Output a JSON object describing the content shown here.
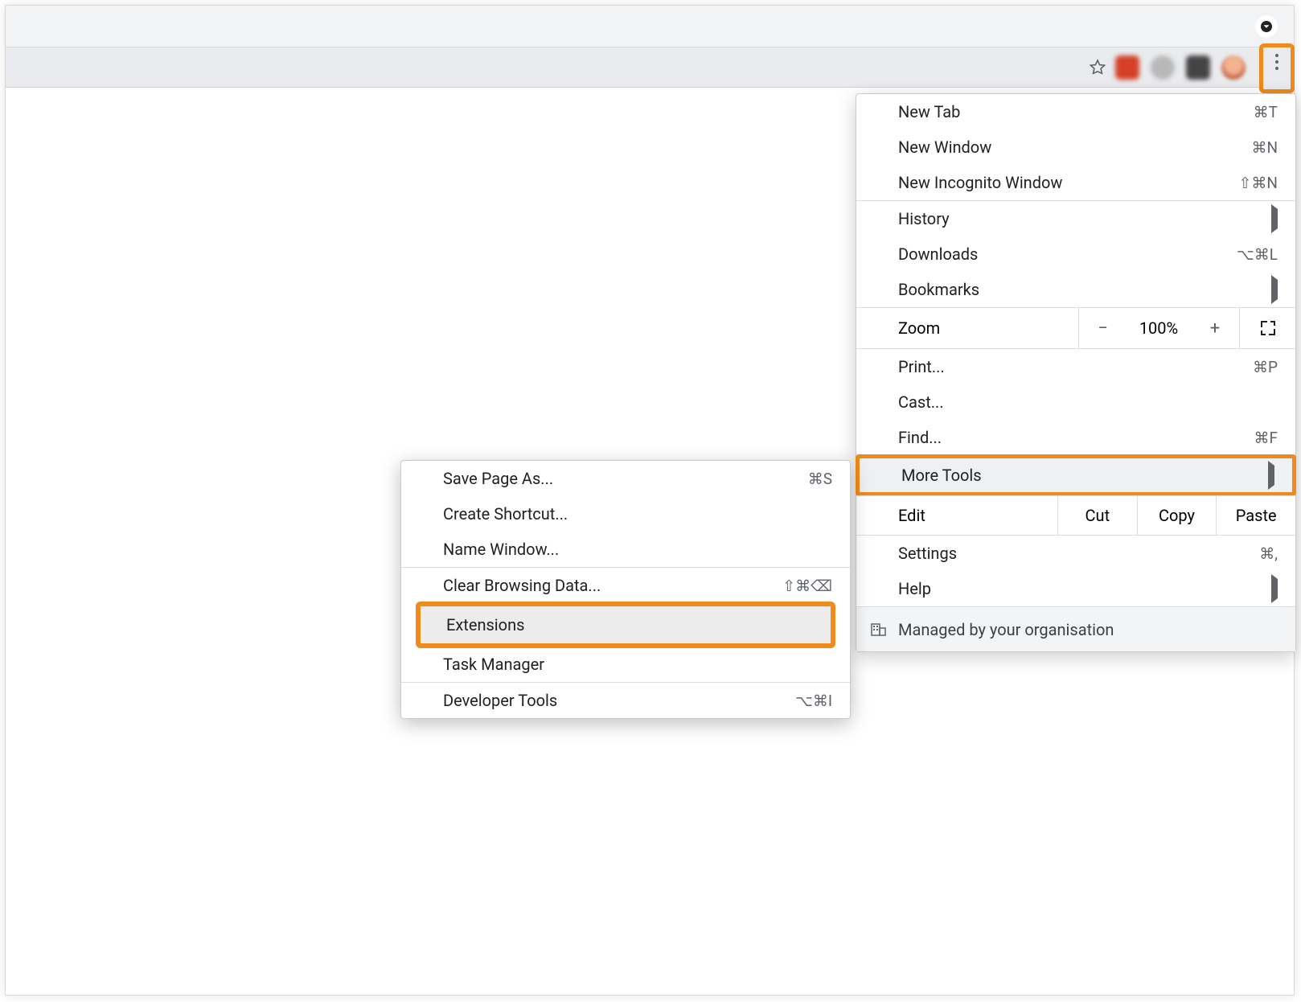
{
  "main_menu": {
    "new_tab": {
      "label": "New Tab",
      "shortcut": "⌘T"
    },
    "new_window": {
      "label": "New Window",
      "shortcut": "⌘N"
    },
    "new_incognito": {
      "label": "New Incognito Window",
      "shortcut": "⇧⌘N"
    },
    "history": {
      "label": "History"
    },
    "downloads": {
      "label": "Downloads",
      "shortcut": "⌥⌘L"
    },
    "bookmarks": {
      "label": "Bookmarks"
    },
    "zoom": {
      "label": "Zoom",
      "minus": "−",
      "percent": "100%",
      "plus": "+"
    },
    "print": {
      "label": "Print...",
      "shortcut": "⌘P"
    },
    "cast": {
      "label": "Cast..."
    },
    "find": {
      "label": "Find...",
      "shortcut": "⌘F"
    },
    "more_tools": {
      "label": "More Tools"
    },
    "edit": {
      "label": "Edit",
      "cut": "Cut",
      "copy": "Copy",
      "paste": "Paste"
    },
    "settings": {
      "label": "Settings",
      "shortcut": "⌘,"
    },
    "help": {
      "label": "Help"
    },
    "managed": {
      "label": "Managed by your organisation"
    }
  },
  "sub_menu": {
    "save_page": {
      "label": "Save Page As...",
      "shortcut": "⌘S"
    },
    "create_shortcut": {
      "label": "Create Shortcut..."
    },
    "name_window": {
      "label": "Name Window..."
    },
    "clear_browsing": {
      "label": "Clear Browsing Data...",
      "shortcut": "⇧⌘⌫"
    },
    "extensions": {
      "label": "Extensions"
    },
    "task_manager": {
      "label": "Task Manager"
    },
    "developer_tools": {
      "label": "Developer Tools",
      "shortcut": "⌥⌘I"
    }
  }
}
